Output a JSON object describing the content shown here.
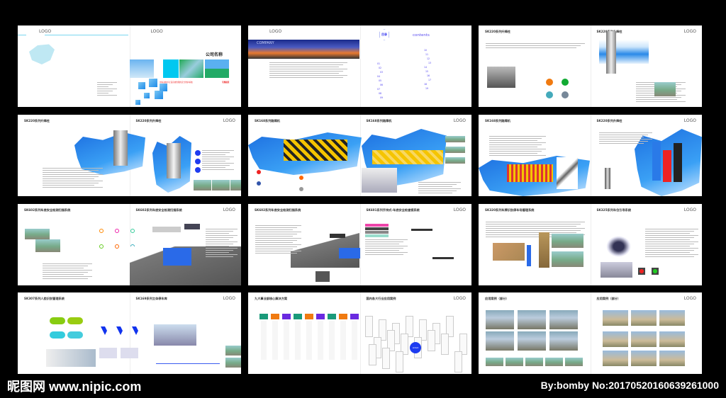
{
  "spreads": [
    {
      "pages": [
        {
          "title": "",
          "logo": "LOGO"
        },
        {
          "title": "公司名称",
          "logo": "LOGO",
          "tagline": "用先进技术打造高效智能的安全防护系统",
          "tag2": "专题报道"
        }
      ]
    },
    {
      "pages": [
        {
          "title": "",
          "logo": "LOGO",
          "banner": "COMPANY"
        },
        {
          "title": "目录",
          "heading": "contents",
          "toc_left": [
            "01",
            "02",
            "03",
            "04",
            "05",
            "06",
            "07",
            "08",
            "09"
          ],
          "toc_right": [
            "10",
            "11",
            "12",
            "13",
            "14",
            "15",
            "16",
            "17",
            "18",
            "19"
          ]
        }
      ]
    },
    {
      "pages": [
        {
          "title": "SK220系列升降柱"
        },
        {
          "title": "SK220系列升降柱",
          "logo": "LOGO"
        }
      ]
    },
    {
      "pages": [
        {
          "title": "SK220系列升降柱"
        },
        {
          "title": "SK220系列升降柱",
          "logo": "LOGO"
        }
      ]
    },
    {
      "pages": [
        {
          "title": "SK168系列路障机"
        },
        {
          "title": "SK168系列路障机",
          "logo": "LOGO"
        }
      ]
    },
    {
      "pages": [
        {
          "title": "SK168系列路障机"
        },
        {
          "title": "SK220系列升降柱",
          "logo": "LOGO"
        }
      ]
    },
    {
      "pages": [
        {
          "title": "SK602系列车底安全检测扫描系统"
        },
        {
          "title": "SK602系列车底安全检测扫描系统",
          "logo": "LOGO"
        }
      ]
    },
    {
      "pages": [
        {
          "title": "SK602系列车底安全检测扫描系统"
        },
        {
          "title": "SK601系列手持式-车底安全检查镜系统",
          "logo": "LOGO"
        }
      ]
    },
    {
      "pages": [
        {
          "title": "SK320系列车牌识别停车场管理系统"
        },
        {
          "title": "SK325系列车位引导系统",
          "logo": "LOGO"
        }
      ]
    },
    {
      "pages": [
        {
          "title": "SK307系列人脸识别管理系统"
        },
        {
          "title": "SK169系列立体停车库",
          "logo": "LOGO"
        }
      ]
    },
    {
      "pages": [
        {
          "title": "九大事业部核心解决方案"
        },
        {
          "title": "国内各大行业应用案例",
          "logo": "LOGO",
          "center_logo": "LOGO"
        }
      ]
    },
    {
      "pages": [
        {
          "title": "应用案例（部分）"
        },
        {
          "title": "应用案例（部分）",
          "logo": "LOGO"
        }
      ]
    }
  ],
  "colors": {
    "accent": "#1e3cf0",
    "brush_blue": "#1d6fe0",
    "sky": "#3aa0f5",
    "tab_green": "#1a9a7a",
    "tab_orange": "#f07a10",
    "tab_purple": "#6a2ae0"
  },
  "footer": {
    "site": "昵图网 www.nipic.com",
    "credit": "By:bomby No:20170520160639261000"
  }
}
